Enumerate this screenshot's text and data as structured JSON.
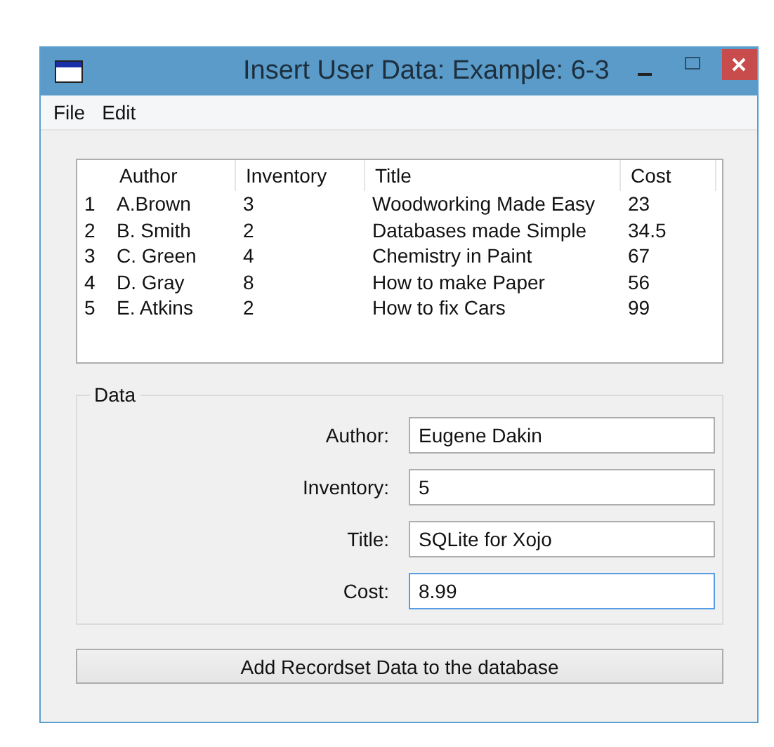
{
  "window": {
    "title": "Insert User Data: Example: 6-3"
  },
  "menu": [
    "File",
    "Edit"
  ],
  "table": {
    "columns": [
      "Author",
      "Inventory",
      "Title",
      "Cost"
    ],
    "rows": [
      {
        "number": "1",
        "cells": [
          "A.Brown",
          "3",
          "Woodworking Made Easy",
          "23"
        ]
      },
      {
        "number": "2",
        "cells": [
          "B. Smith",
          "2",
          "Databases made Simple",
          "34.5"
        ]
      },
      {
        "number": "3",
        "cells": [
          "C. Green",
          "4",
          "Chemistry in Paint",
          "67"
        ]
      },
      {
        "number": "4",
        "cells": [
          "D. Gray",
          "8",
          "How to make Paper",
          "56"
        ]
      },
      {
        "number": "5",
        "cells": [
          "E. Atkins",
          "2",
          "How to fix Cars",
          "99"
        ]
      }
    ]
  },
  "data_group": {
    "title": "Data",
    "fields": [
      {
        "label": "Author:",
        "value": "Eugene Dakin",
        "focused": false
      },
      {
        "label": "Inventory:",
        "value": "5",
        "focused": false
      },
      {
        "label": "Title:",
        "value": "SQLite for Xojo",
        "focused": false
      },
      {
        "label": "Cost:",
        "value": "8.99",
        "focused": true
      }
    ]
  },
  "button": "Add Recordset Data to the database"
}
